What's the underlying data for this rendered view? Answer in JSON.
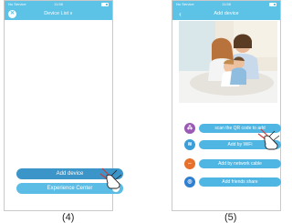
{
  "screens": [
    {
      "status": {
        "carrier": "No Service",
        "time": "11:58"
      },
      "nav_title": "Device List",
      "buttons": {
        "add_device": "Add device",
        "experience_center": "Experience Center"
      },
      "caption": "(4)"
    },
    {
      "status": {
        "carrier": "No Service",
        "time": "11:58"
      },
      "nav_title": "Add device",
      "options": [
        {
          "label": "scan the QR code to add",
          "icon": "qr-icon",
          "color": "#9b59b6"
        },
        {
          "label": "Add by WiFi",
          "icon": "wifi-icon",
          "color": "#3a9fd8"
        },
        {
          "label": "Add by network cable",
          "icon": "cable-icon",
          "color": "#e8702a"
        },
        {
          "label": "Add friends share",
          "icon": "share-icon",
          "color": "#2f7fd0"
        }
      ],
      "caption": "(5)"
    }
  ],
  "colors": {
    "accent": "#5cc2e6",
    "button": "#4fb6e3"
  }
}
